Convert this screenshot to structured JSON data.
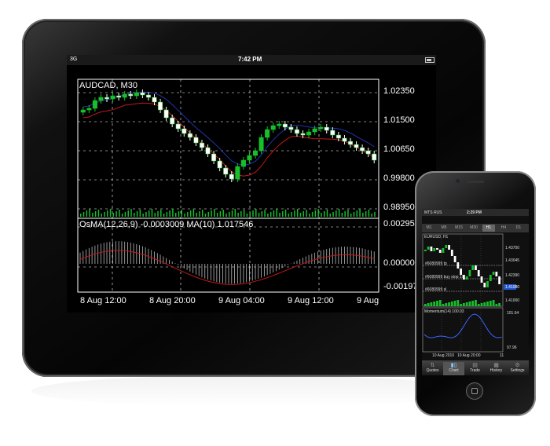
{
  "ipad": {
    "status": {
      "carrier": "3G",
      "time": "7:42 PM"
    },
    "main_chart": {
      "title": "AUDCAD, M30",
      "y_ticks": [
        "1.02350",
        "1.01500",
        "1.00650",
        "0.99800",
        "0.98950"
      ],
      "colors": {
        "up": "#16c02a",
        "down": "#ffffff",
        "ma_fast": "#2233aa",
        "ma_slow": "#c01818",
        "grid": "#ffffff",
        "volume": "#16c02a"
      }
    },
    "indicator": {
      "label": "OsMA(12,26,9) -0.0003009 MA(10) 1.017546",
      "y_ticks": [
        "0.00295",
        "0.00000",
        "-0.00197"
      ]
    },
    "x_ticks": [
      "8 Aug 12:00",
      "8 Aug 20:00",
      "9 Aug 04:00",
      "9 Aug 12:00",
      "9 Aug"
    ]
  },
  "iphone": {
    "status": {
      "carrier": "MTS RUS",
      "time": "2:29 PM"
    },
    "timeframes": [
      "M1",
      "M5",
      "M15",
      "M30",
      "H1",
      "H4",
      "D1"
    ],
    "active_timeframe": "H1",
    "chart_title": "EURUSD, H1",
    "price_ticks": [
      "1.43700",
      "1.43045",
      "1.42390",
      "1.41000",
      "1.41080"
    ],
    "order_lines": [
      "#6080999 tp",
      "#6080999 buy stop 10",
      "#6080999 sl"
    ],
    "indicator_label": "Momentum(14) 100.03",
    "indicator_ticks": [
      "101.64",
      "97.96"
    ],
    "x_ticks": [
      "10 Aug 2010",
      "10 Aug 20:00",
      "11"
    ],
    "nav": [
      "Quotes",
      "Chart",
      "Trade",
      "History",
      "Settings"
    ],
    "active_nav": "Chart"
  }
}
